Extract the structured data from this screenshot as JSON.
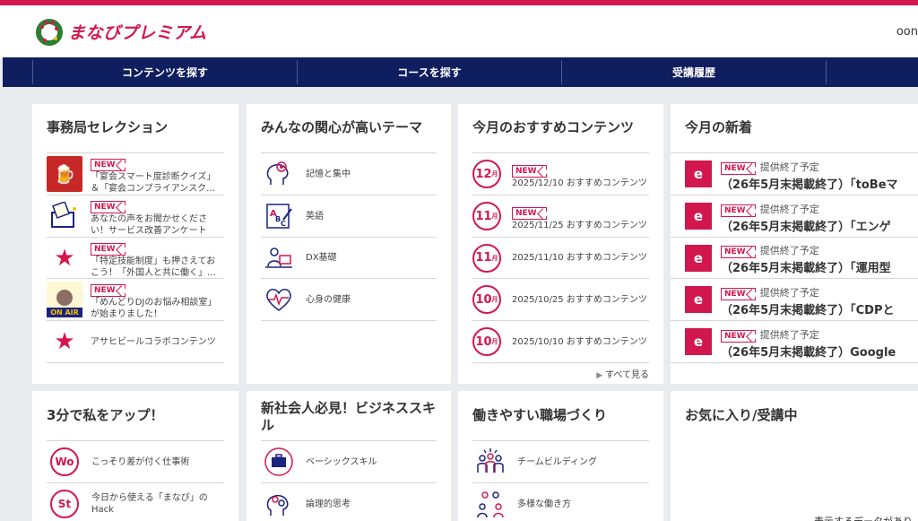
{
  "header": {
    "logo_text": "まなびプレミアム",
    "user_text": "oon"
  },
  "nav": [
    "コンテンツを探す",
    "コースを探す",
    "受講履歴"
  ],
  "cards": {
    "selection": {
      "title": "事務局セレクション",
      "items": [
        {
          "new": "NEW",
          "text": "「宴会スマート度診断クイズ」＆「宴会コンプライアンスク…"
        },
        {
          "new": "NEW",
          "text": "あなたの声をお聞かせください！サービス改善アンケート"
        },
        {
          "new": "NEW",
          "text": "「特定技能制度」も押さえておこう！「外国人と共に働く」…"
        },
        {
          "new": "NEW",
          "text": "「めんどりDJのお悩み相談室」が始まりました！",
          "badge": "ON AIR"
        },
        {
          "text": "アサヒビールコラボコンテンツ"
        }
      ]
    },
    "themes": {
      "title": "みんなの関心が高いテーマ",
      "items": [
        "記憶と集中",
        "英語",
        "DX基礎",
        "心身の健康"
      ]
    },
    "recommend": {
      "title": "今月のおすすめコンテンツ",
      "items": [
        {
          "month": "12",
          "unit": "月",
          "new": "NEW",
          "text": "2025/12/10 おすすめコンテンツ"
        },
        {
          "month": "11",
          "unit": "月",
          "new": "NEW",
          "text": "2025/11/25 おすすめコンテンツ"
        },
        {
          "month": "11",
          "unit": "月",
          "text": "2025/11/10 おすすめコンテンツ"
        },
        {
          "month": "10",
          "unit": "月",
          "text": "2025/10/25 おすすめコンテンツ"
        },
        {
          "month": "10",
          "unit": "月",
          "text": "2025/10/10 おすすめコンテンツ"
        }
      ],
      "see_all": "すべて見る"
    },
    "newarrivals": {
      "title": "今月の新着",
      "items": [
        {
          "new": "NEW",
          "status": "提供終了予定",
          "text": "（26年5月末掲載終了）「toBeマ"
        },
        {
          "new": "NEW",
          "status": "提供終了予定",
          "text": "（26年5月末掲載終了）「エンゲ"
        },
        {
          "new": "NEW",
          "status": "提供終了予定",
          "text": "（26年5月末掲載終了）「運用型"
        },
        {
          "new": "NEW",
          "status": "提供終了予定",
          "text": "（26年5月末掲載終了）「CDPと"
        },
        {
          "new": "NEW",
          "status": "提供終了予定",
          "text": "（26年5月末掲載終了）Google"
        }
      ]
    },
    "threemin": {
      "title": "3分で私をアップ！",
      "items": [
        {
          "icon": "Wo",
          "text": "こっそり差が付く仕事術"
        },
        {
          "icon": "St",
          "text": "今日から使える「まなび」のHack"
        }
      ]
    },
    "business": {
      "title": "新社会人必見！ビジネススキル",
      "items": [
        "ベーシックスキル",
        "論理的思考"
      ]
    },
    "workplace": {
      "title": "働きやすい職場づくり",
      "items": [
        "チームビルディング",
        "多様な働き方"
      ]
    },
    "favorites": {
      "title": "お気に入り/受講中",
      "empty": "表示するデータがあり"
    }
  }
}
